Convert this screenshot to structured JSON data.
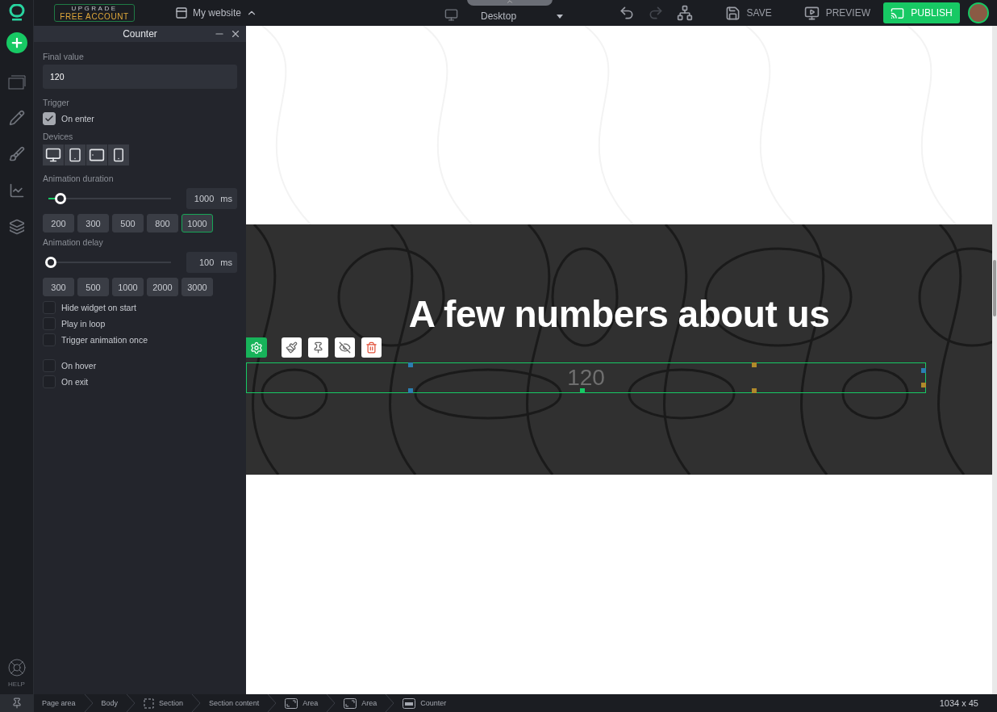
{
  "topbar": {
    "upgrade": {
      "line1": "UPGRADE",
      "line2": "FREE ACCOUNT"
    },
    "site_name": "My website",
    "device": "Desktop",
    "save": "SAVE",
    "preview": "PREVIEW",
    "publish": "PUBLISH"
  },
  "sidebar": {
    "help": "HELP"
  },
  "panel": {
    "title": "Counter",
    "final_value": {
      "label": "Final value",
      "value": "120"
    },
    "trigger": {
      "label": "Trigger",
      "options": [
        {
          "label": "On enter",
          "checked": true
        }
      ]
    },
    "devices": {
      "label": "Devices",
      "items": [
        {
          "kind": "desktop"
        },
        {
          "kind": "tablet-portrait"
        },
        {
          "kind": "tablet-landscape"
        },
        {
          "kind": "phone"
        }
      ]
    },
    "duration": {
      "label": "Animation duration",
      "level": 0.1,
      "value": "1000",
      "unit": "ms",
      "presets": [
        {
          "label": "200",
          "selected": false
        },
        {
          "label": "300",
          "selected": false
        },
        {
          "label": "500",
          "selected": false
        },
        {
          "label": "800",
          "selected": false
        },
        {
          "label": "1000",
          "selected": true
        }
      ]
    },
    "delay": {
      "label": "Animation delay",
      "level": 0.02,
      "value": "100",
      "unit": "ms",
      "presets": [
        {
          "label": "300",
          "selected": false
        },
        {
          "label": "500",
          "selected": false
        },
        {
          "label": "1000",
          "selected": false
        },
        {
          "label": "2000",
          "selected": false
        },
        {
          "label": "3000",
          "selected": false
        }
      ]
    },
    "options": [
      {
        "label": "Hide widget on start",
        "checked": false
      },
      {
        "label": "Play in loop",
        "checked": false
      },
      {
        "label": "Trigger animation once",
        "checked": false
      }
    ],
    "events": [
      {
        "label": "On hover",
        "checked": false
      },
      {
        "label": "On exit",
        "checked": false
      }
    ]
  },
  "canvas": {
    "heading": "A few numbers about us",
    "counter": "120"
  },
  "breadcrumbs": [
    {
      "label": "Page area",
      "kind": "plain"
    },
    {
      "label": "Body",
      "kind": "plain"
    },
    {
      "label": "Section",
      "kind": "section"
    },
    {
      "label": "Section content",
      "kind": "plain"
    },
    {
      "label": "Area",
      "kind": "area"
    },
    {
      "label": "Area",
      "kind": "area"
    },
    {
      "label": "Counter",
      "kind": "counter"
    }
  ],
  "size": "1034 x 45"
}
